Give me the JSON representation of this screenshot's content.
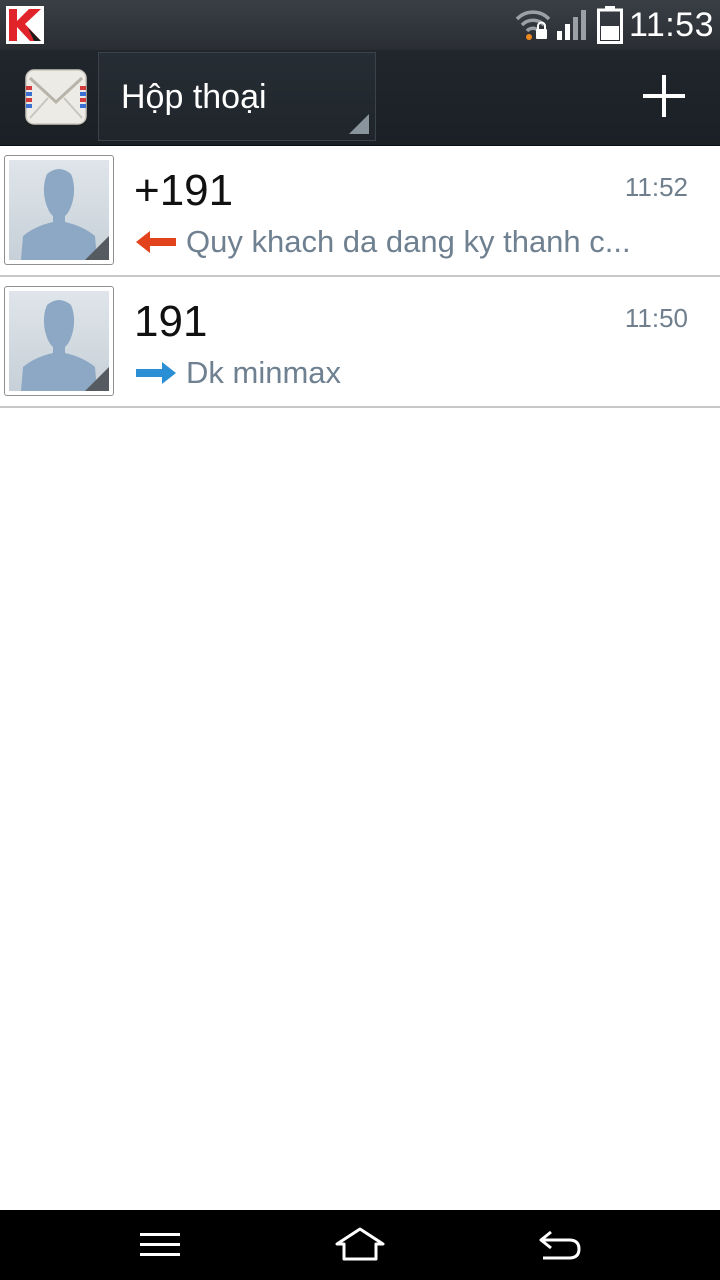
{
  "status_bar": {
    "time": "11:53",
    "icons": [
      "kaspersky-icon",
      "wifi-locked-icon",
      "signal-icon",
      "battery-icon"
    ]
  },
  "action_bar": {
    "spinner_label": "Hộp thoại",
    "icons": [
      "messaging-app-icon",
      "plus-icon"
    ]
  },
  "conversations": [
    {
      "sender": "+191",
      "time": "11:52",
      "direction": "incoming",
      "direction_icon": "incoming-arrow-icon",
      "preview": "Quy khach da dang ky thanh c..."
    },
    {
      "sender": "191",
      "time": "11:50",
      "direction": "outgoing",
      "direction_icon": "outgoing-arrow-icon",
      "preview": "Dk minmax"
    }
  ],
  "nav_bar": {
    "icons": [
      "menu-icon",
      "home-icon",
      "back-icon"
    ]
  },
  "colors": {
    "status_bar": "#2f3439",
    "action_bar": "#1f252a",
    "incoming_arrow": "#e2421c",
    "outgoing_arrow": "#2b8fd6",
    "preview_text": "#6f8090",
    "time_text": "#6f7f8e",
    "divider": "#c7c7c7"
  }
}
